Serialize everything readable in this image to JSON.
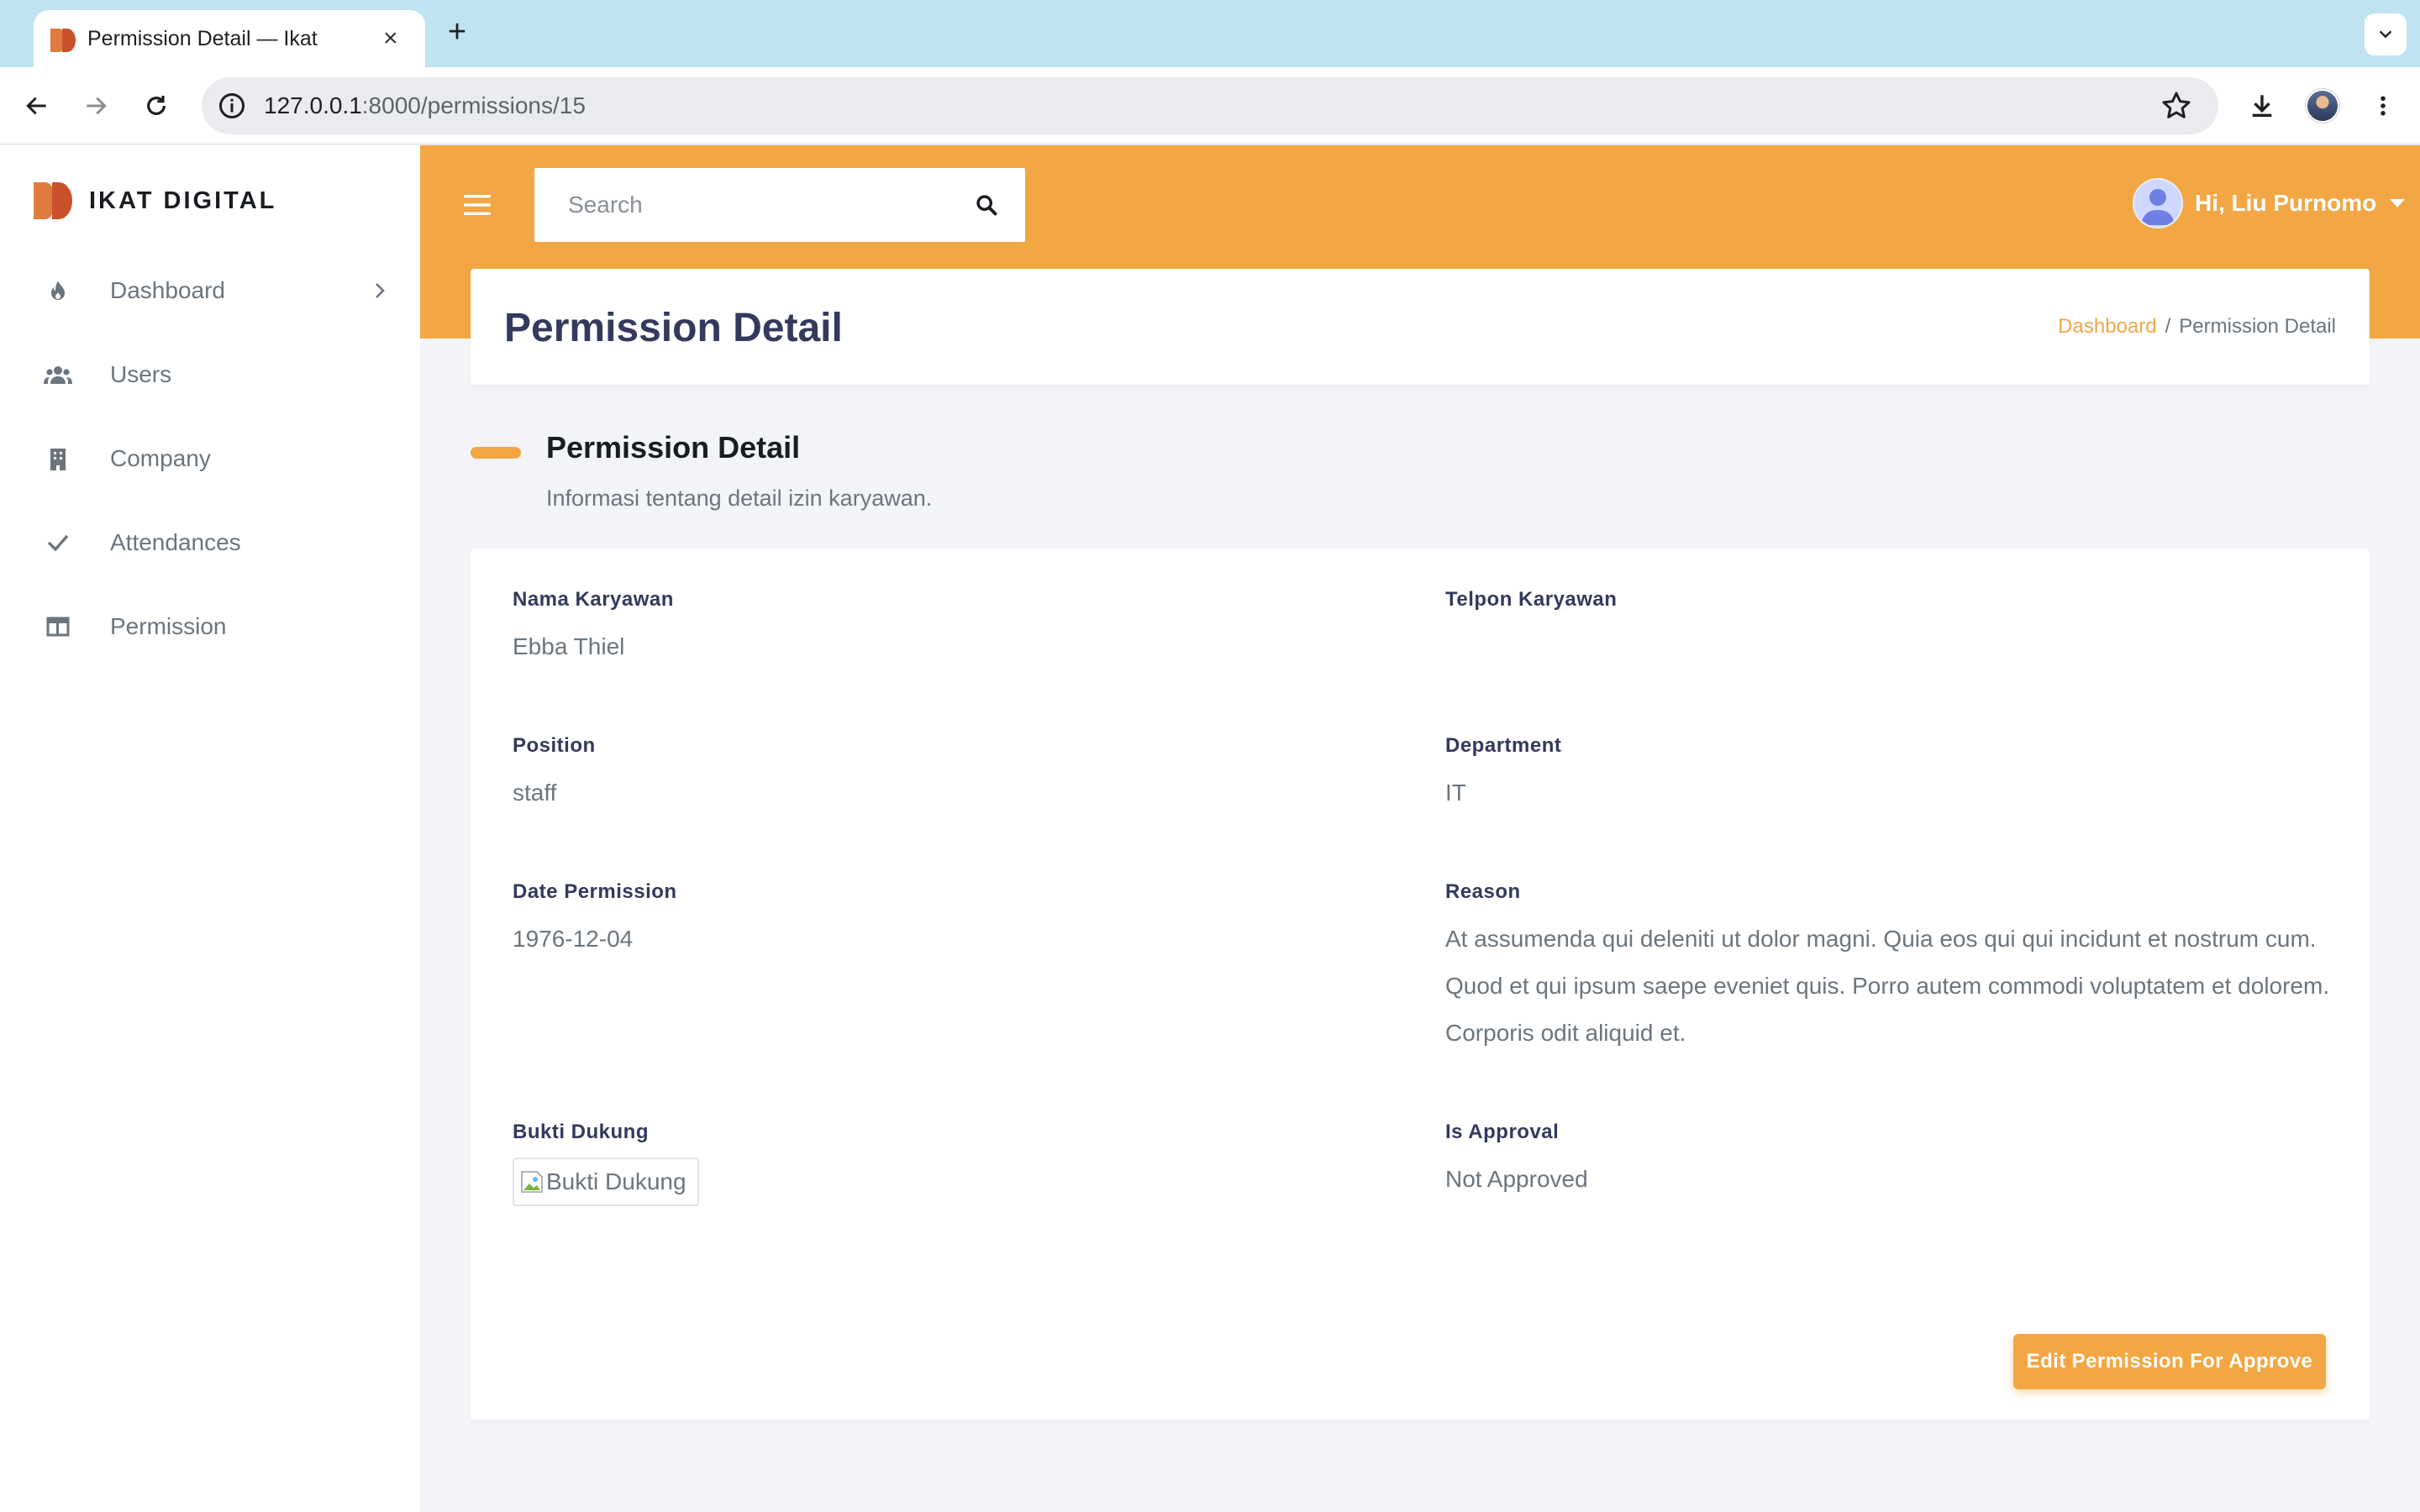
{
  "browser": {
    "tab_title": "Permission Detail — Ikat",
    "tab_close": "×",
    "new_tab": "+",
    "url_host": "127.0.0.1",
    "url_rest": ":8000/permissions/15"
  },
  "colors": {
    "accent": "#f2a744",
    "sidebar_bg": "#ffffff",
    "page_bg": "#f3f4f7",
    "title_text": "#34395e",
    "muted_text": "#6c757d"
  },
  "sidebar": {
    "brand": "IKAT DIGITAL",
    "items": [
      {
        "label": "Dashboard",
        "icon": "fire-icon",
        "has_chevron": true
      },
      {
        "label": "Users",
        "icon": "users-icon"
      },
      {
        "label": "Company",
        "icon": "building-icon"
      },
      {
        "label": "Attendances",
        "icon": "check-icon"
      },
      {
        "label": "Permission",
        "icon": "table-icon"
      }
    ]
  },
  "topnav": {
    "search_placeholder": "Search",
    "user_greeting": "Hi, Liu Purnomo"
  },
  "header": {
    "title": "Permission Detail",
    "breadcrumb": [
      "Dashboard",
      "Permission Detail"
    ],
    "breadcrumb_sep": "/"
  },
  "section": {
    "title": "Permission Detail",
    "description": "Informasi tentang detail izin karyawan."
  },
  "details": {
    "nama_label": "Nama Karyawan",
    "nama_value": "Ebba Thiel",
    "telpon_label": "Telpon Karyawan",
    "telpon_value": "",
    "position_label": "Position",
    "position_value": "staff",
    "department_label": "Department",
    "department_value": "IT",
    "date_label": "Date Permission",
    "date_value": "1976-12-04",
    "reason_label": "Reason",
    "reason_value": "At assumenda qui deleniti ut dolor magni. Quia eos qui qui incidunt et nostrum cum. Quod et qui ipsum saepe eveniet quis. Porro autem commodi voluptatem et dolorem. Corporis odit aliquid et.",
    "bukti_label": "Bukti Dukung",
    "bukti_alt": "Bukti Dukung",
    "approval_label": "Is Approval",
    "approval_value": "Not Approved"
  },
  "actions": {
    "edit_label": "Edit Permission For Approve"
  }
}
